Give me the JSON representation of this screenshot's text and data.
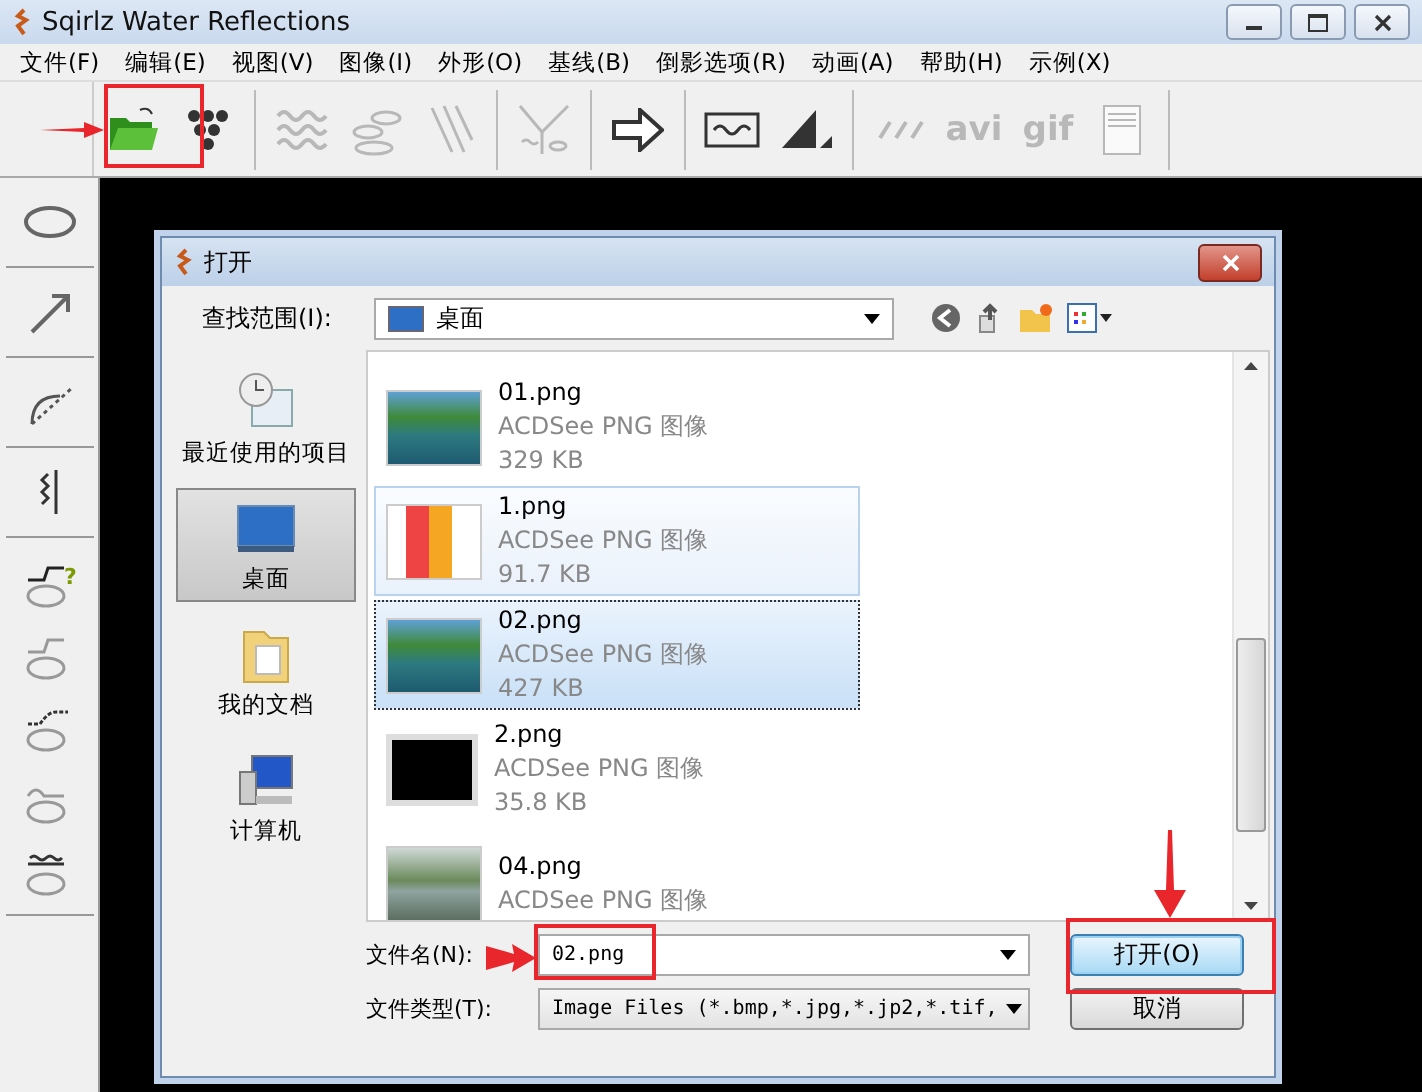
{
  "window": {
    "title": "Sqirlz Water Reflections"
  },
  "menu": [
    {
      "label": "文件(F)"
    },
    {
      "label": "编辑(E)"
    },
    {
      "label": "视图(V)"
    },
    {
      "label": "图像(I)"
    },
    {
      "label": "外形(O)"
    },
    {
      "label": "基线(B)"
    },
    {
      "label": "倒影选项(R)"
    },
    {
      "label": "动画(A)"
    },
    {
      "label": "帮助(H)"
    },
    {
      "label": "示例(X)"
    }
  ],
  "toolbar": [
    {
      "kind": "open",
      "disabled": false
    },
    {
      "kind": "drops",
      "disabled": false
    },
    {
      "kind": "separator"
    },
    {
      "kind": "waves",
      "disabled": true
    },
    {
      "kind": "ellipses",
      "disabled": true
    },
    {
      "kind": "lines",
      "disabled": true
    },
    {
      "kind": "separator"
    },
    {
      "kind": "funnel",
      "disabled": true
    },
    {
      "kind": "separator"
    },
    {
      "kind": "arrow",
      "disabled": false
    },
    {
      "kind": "separator"
    },
    {
      "kind": "wavebox",
      "disabled": false
    },
    {
      "kind": "triangle",
      "disabled": false
    },
    {
      "kind": "separator"
    },
    {
      "kind": "slashes",
      "disabled": true
    },
    {
      "kind": "text",
      "label": "avi",
      "disabled": true
    },
    {
      "kind": "text",
      "label": "gif",
      "disabled": true
    },
    {
      "kind": "page",
      "disabled": true
    }
  ],
  "tools": [
    {
      "kind": "ellipse"
    },
    {
      "kind": "separator"
    },
    {
      "kind": "arrow"
    },
    {
      "kind": "separator"
    },
    {
      "kind": "arc"
    },
    {
      "kind": "separator"
    },
    {
      "kind": "zigzag"
    },
    {
      "kind": "separator"
    },
    {
      "kind": "help-ripple",
      "mark": "?"
    },
    {
      "kind": "step-ripple"
    },
    {
      "kind": "dotted-ripple"
    },
    {
      "kind": "curve-ripple"
    },
    {
      "kind": "wave-ripple"
    },
    {
      "kind": "separator"
    }
  ],
  "dialog": {
    "title": "打开",
    "look_in_label": "查找范围(I):",
    "look_in_value": "桌面",
    "places": [
      {
        "label": "最近使用的项目",
        "kind": "recent",
        "selected": false
      },
      {
        "label": "桌面",
        "kind": "desktop",
        "selected": true
      },
      {
        "label": "我的文档",
        "kind": "documents",
        "selected": false
      },
      {
        "label": "计算机",
        "kind": "computer",
        "selected": false
      }
    ],
    "files": [
      {
        "name": "01.png",
        "type": "ACDSee PNG 图像",
        "size": "329 KB",
        "kind": "lake",
        "selected": false,
        "hovered": false
      },
      {
        "name": "1.png",
        "type": "ACDSee PNG 图像",
        "size": "91.7 KB",
        "kind": "screen",
        "selected": false,
        "hovered": true
      },
      {
        "name": "02.png",
        "type": "ACDSee PNG 图像",
        "size": "427 KB",
        "kind": "lake",
        "selected": true,
        "hovered": false
      },
      {
        "name": "2.png",
        "type": "ACDSee PNG 图像",
        "size": "35.8 KB",
        "kind": "black",
        "selected": false,
        "hovered": false
      },
      {
        "name": "04.png",
        "type": "ACDSee PNG 图像",
        "kind": "river",
        "selected": false,
        "hovered": false
      }
    ],
    "file_name_label": "文件名(N):",
    "file_name": "02.png",
    "file_type_label": "文件类型(T):",
    "file_type": "Image Files (*.bmp,*.jpg,*.jp2,*.tif,",
    "buttons": [
      {
        "label": "打开(O)",
        "default": true
      },
      {
        "label": "取消",
        "default": false
      }
    ]
  }
}
